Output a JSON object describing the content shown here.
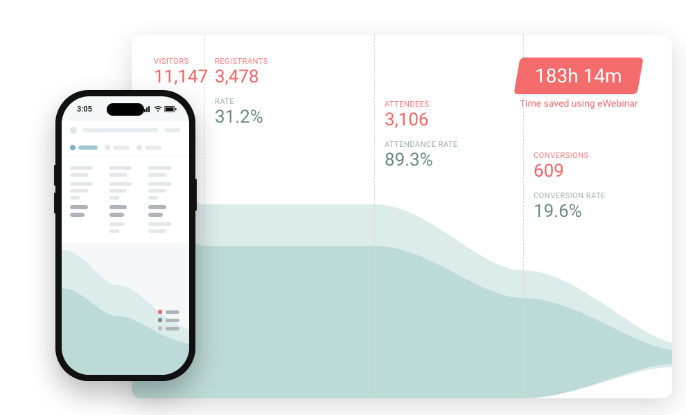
{
  "metrics": {
    "visitors": {
      "label": "VISITORS",
      "value": "11,147"
    },
    "registrants": {
      "label": "REGISTRANTS",
      "value": "3,478",
      "rate_label": "RATE",
      "rate_value": "31.2%"
    },
    "attendees": {
      "label": "ATTENDEES",
      "value": "3,106",
      "rate_label": "ATTENDANCE RATE",
      "rate_value": "89.3%"
    },
    "conversions": {
      "label": "CONVERSIONS",
      "value": "609",
      "rate_label": "CONVERSION RATE",
      "rate_value": "19.6%"
    }
  },
  "savings": {
    "headline": "183h 14m",
    "caption": "Time saved using eWebinar"
  },
  "phone": {
    "time": "3:05"
  },
  "colors": {
    "accent": "#f36b6b",
    "funnel_light": "#dceceb",
    "funnel_dark": "#bcdad7",
    "metric_red": "#f36565",
    "metric_grey": "#6d8a87"
  },
  "chart_data": {
    "type": "funnel",
    "stages": [
      {
        "name": "Visitors",
        "value": 11147
      },
      {
        "name": "Registrants",
        "value": 3478,
        "rate_of_prev": 31.2
      },
      {
        "name": "Attendees",
        "value": 3106,
        "rate_of_prev": 89.3
      },
      {
        "name": "Conversions",
        "value": 609,
        "rate_of_prev": 19.6
      }
    ],
    "ylim": [
      0,
      11147
    ]
  }
}
